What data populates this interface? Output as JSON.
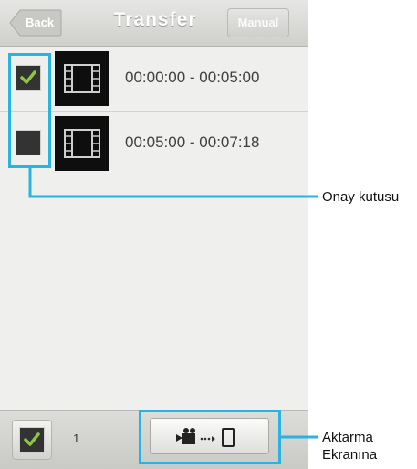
{
  "header": {
    "back_label": "Back",
    "title": "Transfer",
    "manual_label": "Manual"
  },
  "rows": [
    {
      "checked": true,
      "time_range": "00:00:00 - 00:05:00"
    },
    {
      "checked": false,
      "time_range": "00:05:00 - 00:07:18"
    }
  ],
  "footer": {
    "selected_count": "1"
  },
  "annotations": {
    "checkbox_label": "Onay kutusu",
    "transfer_label": "Aktarma Ekranına"
  },
  "colors": {
    "callout": "#29b3e0",
    "check": "#8dc63f"
  },
  "icons": [
    "film-icon",
    "check-icon",
    "camera-icon",
    "phone-icon",
    "arrow-dots-icon"
  ]
}
